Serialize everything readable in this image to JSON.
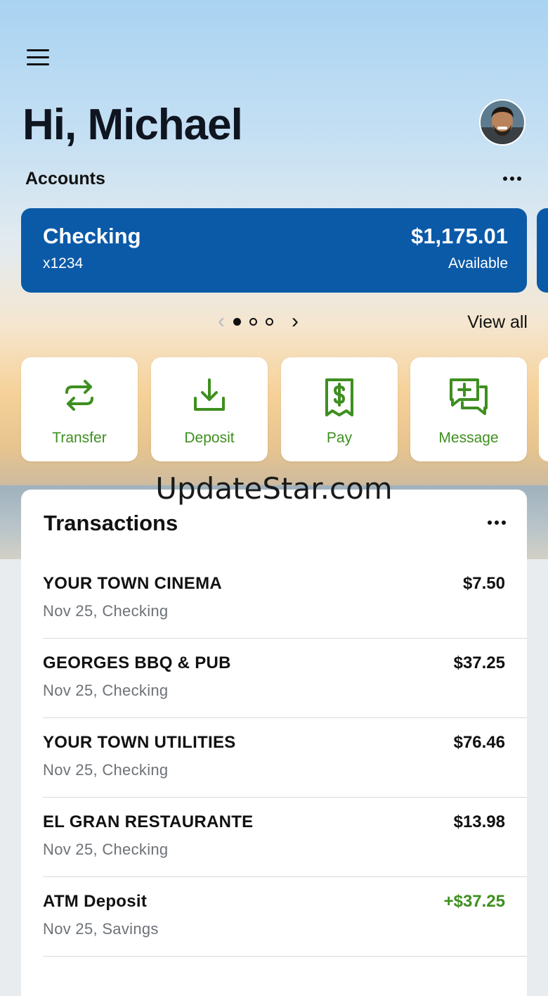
{
  "header": {
    "greeting": "Hi, Michael"
  },
  "accounts": {
    "label": "Accounts",
    "card": {
      "name": "Checking",
      "number": "x1234",
      "balance": "$1,175.01",
      "balance_label": "Available"
    },
    "pager": {
      "total": 3,
      "active": 1
    },
    "view_all": "View all"
  },
  "actions": [
    {
      "label": "Transfer",
      "icon": "transfer-arrows-icon"
    },
    {
      "label": "Deposit",
      "icon": "download-tray-icon"
    },
    {
      "label": "Pay",
      "icon": "dollar-receipt-icon"
    },
    {
      "label": "Message",
      "icon": "chat-plus-icon"
    }
  ],
  "watermark": "UpdateStar.com",
  "transactions": {
    "title": "Transactions",
    "items": [
      {
        "merchant": "YOUR TOWN CINEMA",
        "detail": "Nov 25, Checking",
        "amount": "$7.50"
      },
      {
        "merchant": "GEORGES BBQ & PUB",
        "detail": "Nov 25, Checking",
        "amount": "$37.25"
      },
      {
        "merchant": "YOUR TOWN UTILITIES",
        "detail": "Nov 25, Checking",
        "amount": "$76.46"
      },
      {
        "merchant": "EL GRAN RESTAURANTE",
        "detail": "Nov 25, Checking",
        "amount": "$13.98"
      },
      {
        "merchant": "ATM Deposit",
        "detail": "Nov 25, Savings",
        "amount": "+$37.25"
      }
    ]
  },
  "colors": {
    "brand_blue": "#0b5aa8",
    "action_green": "#3e8f1f",
    "text_dark": "#111111",
    "text_muted": "#6d7277"
  }
}
